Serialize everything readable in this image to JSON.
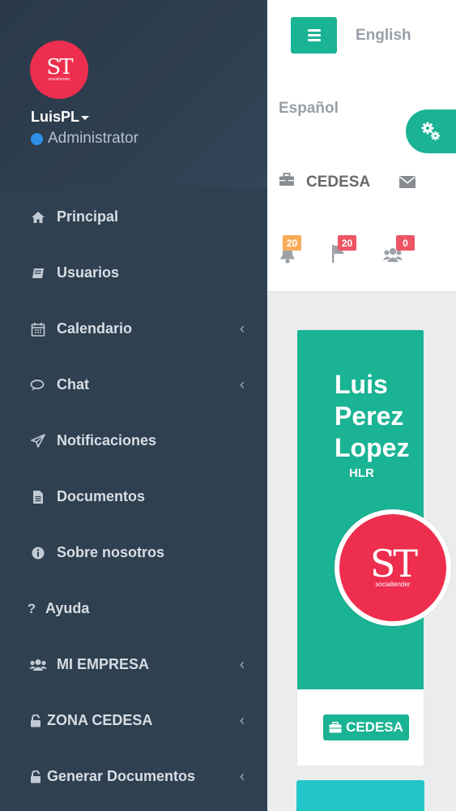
{
  "profile": {
    "avatar_logo": "ST",
    "avatar_logo_sub": "socialtender",
    "username": "LuisPL",
    "role": "Administrator",
    "status_color": "#2e8ee8"
  },
  "sidebar": {
    "items": [
      {
        "label": "Principal",
        "icon": "home-icon",
        "has_submenu": false
      },
      {
        "label": "Usuarios",
        "icon": "book-icon",
        "has_submenu": false
      },
      {
        "label": "Calendario",
        "icon": "calendar-icon",
        "has_submenu": true
      },
      {
        "label": "Chat",
        "icon": "chat-icon",
        "has_submenu": true
      },
      {
        "label": "Notificaciones",
        "icon": "paper-plane-icon",
        "has_submenu": false
      },
      {
        "label": "Documentos",
        "icon": "document-icon",
        "has_submenu": false
      },
      {
        "label": "Sobre nosotros",
        "icon": "info-icon",
        "has_submenu": false
      },
      {
        "label": "Ayuda",
        "icon": "question-icon",
        "has_submenu": false
      },
      {
        "label": "MI EMPRESA",
        "icon": "users-icon",
        "has_submenu": true
      },
      {
        "label": "ZONA CEDESA",
        "icon": "unlock-icon",
        "has_submenu": true
      },
      {
        "label": "Generar Documentos",
        "icon": "unlock-icon",
        "has_submenu": true
      }
    ]
  },
  "topbar": {
    "lang_en": "English",
    "lang_es": "Español",
    "company": "CEDESA",
    "notifications": [
      {
        "icon": "bell-icon",
        "count": "20",
        "color": "#f8ac59"
      },
      {
        "icon": "flag-icon",
        "count": "20",
        "color": "#ed5565"
      },
      {
        "icon": "users-icon",
        "count": "0",
        "color": "#ed5565"
      }
    ]
  },
  "card": {
    "name": "Luis Perez Lopez",
    "name_line1": "Luis",
    "name_line2": "Perez",
    "name_line3": "Lopez",
    "subtitle": "HLR",
    "logo": "ST",
    "logo_sub": "socialtender",
    "company_button": "CEDESA"
  },
  "colors": {
    "sidebar_bg": "#2f4050",
    "accent": "#1ab394",
    "brand_red": "#ee2e4e",
    "teal_card": "#23c6c8"
  }
}
